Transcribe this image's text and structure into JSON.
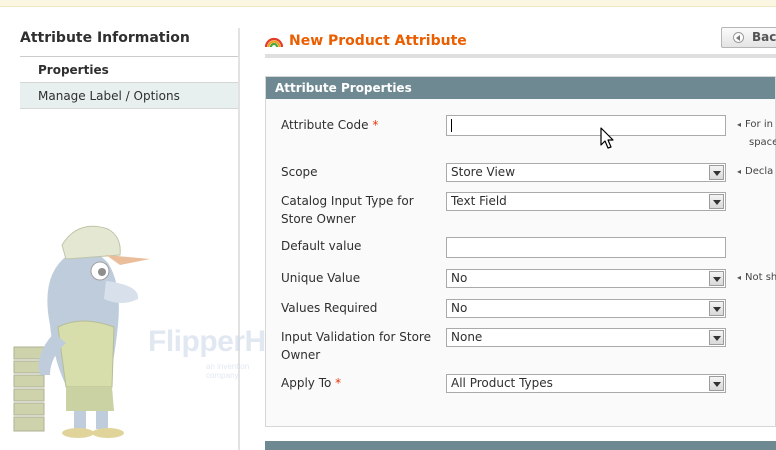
{
  "sidebar": {
    "title": "Attribute Information",
    "items": [
      {
        "label": "Properties"
      },
      {
        "label": "Manage Label / Options"
      }
    ]
  },
  "watermark": {
    "brand": "FlipperHost",
    "tagline": "an invention company",
    "cap_text": "FLIPPER HOST"
  },
  "header": {
    "title": "New Product Attribute",
    "back_label": "Back"
  },
  "fieldset": {
    "title": "Attribute Properties",
    "fields": {
      "attribute_code": {
        "label": "Attribute Code",
        "required": "*",
        "value": "",
        "note": "For in",
        "note2": "space"
      },
      "scope": {
        "label": "Scope",
        "value": "Store View",
        "note": "Decla"
      },
      "catalog_input": {
        "label": "Catalog Input Type for Store Owner",
        "value": "Text Field"
      },
      "default_value": {
        "label": "Default value",
        "value": ""
      },
      "unique_value": {
        "label": "Unique Value",
        "value": "No",
        "note": "Not sh"
      },
      "values_required": {
        "label": "Values Required",
        "value": "No"
      },
      "input_validation": {
        "label": "Input Validation for Store Owner",
        "value": "None"
      },
      "apply_to": {
        "label": "Apply To",
        "required": "*",
        "value": "All Product Types"
      }
    }
  },
  "colors": {
    "accent_orange": "#eb5e00",
    "section_header": "#6f8992",
    "required": "#eb340a"
  }
}
